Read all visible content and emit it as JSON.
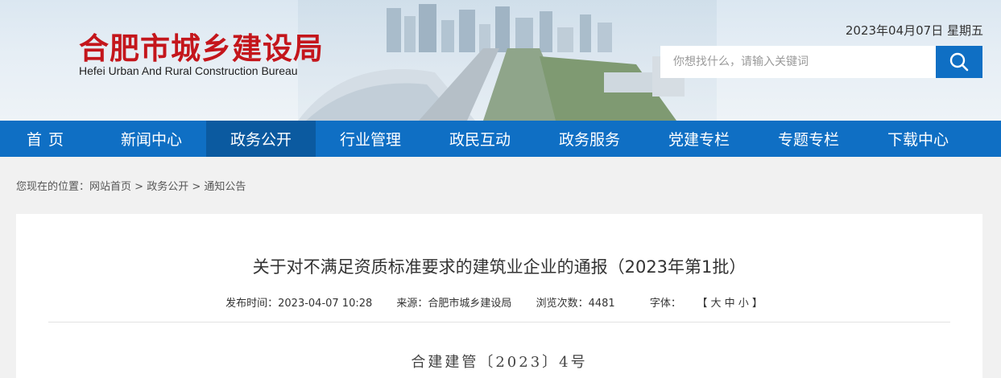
{
  "header": {
    "logo_cn": "合肥市城乡建设局",
    "logo_en": "Hefei Urban And Rural Construction Bureau",
    "date": "2023年04月07日 星期五",
    "search": {
      "placeholder": "你想找什么，请输入关键词"
    }
  },
  "nav": {
    "items": [
      {
        "label": "首页"
      },
      {
        "label": "新闻中心"
      },
      {
        "label": "政务公开"
      },
      {
        "label": "行业管理"
      },
      {
        "label": "政民互动"
      },
      {
        "label": "政务服务"
      },
      {
        "label": "党建专栏"
      },
      {
        "label": "专题专栏"
      },
      {
        "label": "下载中心"
      }
    ],
    "active_index": 2
  },
  "breadcrumb": {
    "prefix": "您现在的位置：",
    "items": [
      "网站首页",
      "政务公开",
      "通知公告"
    ],
    "separator": " > "
  },
  "article": {
    "title": "关于对不满足资质标准要求的建筑业企业的通报（2023年第1批）",
    "publish_time": "发布时间：2023-04-07 10:28",
    "source": "来源：合肥市城乡建设局",
    "views": "浏览次数：4481",
    "font_label": "字体：",
    "font_sizes": "【 大 中 小 】",
    "doc_number": "合建建管〔2023〕4号"
  },
  "colors": {
    "brand_blue": "#0f6fc4",
    "active_blue": "#0b5aa0",
    "logo_red": "#c4161c"
  }
}
